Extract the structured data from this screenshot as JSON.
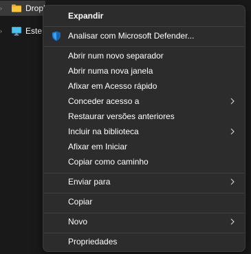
{
  "explorer": {
    "tree": [
      {
        "label": "Dropbox",
        "icon": "folder-icon",
        "selected": true
      },
      {
        "label": "Este PC",
        "icon": "monitor-icon",
        "selected": false
      }
    ]
  },
  "context_menu": {
    "items": {
      "expand": {
        "label": "Expandir"
      },
      "defender": {
        "label": "Analisar com Microsoft Defender...",
        "icon": "shield-icon"
      },
      "new_tab": {
        "label": "Abrir num novo separador"
      },
      "new_window": {
        "label": "Abrir numa nova janela"
      },
      "pin_quick": {
        "label": "Afixar em Acesso rápido"
      },
      "give_access": {
        "label": "Conceder acesso a",
        "submenu": true
      },
      "restore": {
        "label": "Restaurar versões anteriores"
      },
      "library": {
        "label": "Incluir na biblioteca",
        "submenu": true
      },
      "pin_start": {
        "label": "Afixar em Iniciar"
      },
      "copy_path": {
        "label": "Copiar como caminho"
      },
      "send_to": {
        "label": "Enviar para",
        "submenu": true
      },
      "copy": {
        "label": "Copiar"
      },
      "new": {
        "label": "Novo",
        "submenu": true
      },
      "properties": {
        "label": "Propriedades"
      }
    }
  },
  "colors": {
    "menu_bg": "#2c2c2c",
    "menu_border": "#3d3d3d",
    "separator": "#404040",
    "text": "#ffffff",
    "folder": "#f4c53d",
    "defender_shield": "#1b7fd6",
    "monitor": "#29a8e0"
  }
}
